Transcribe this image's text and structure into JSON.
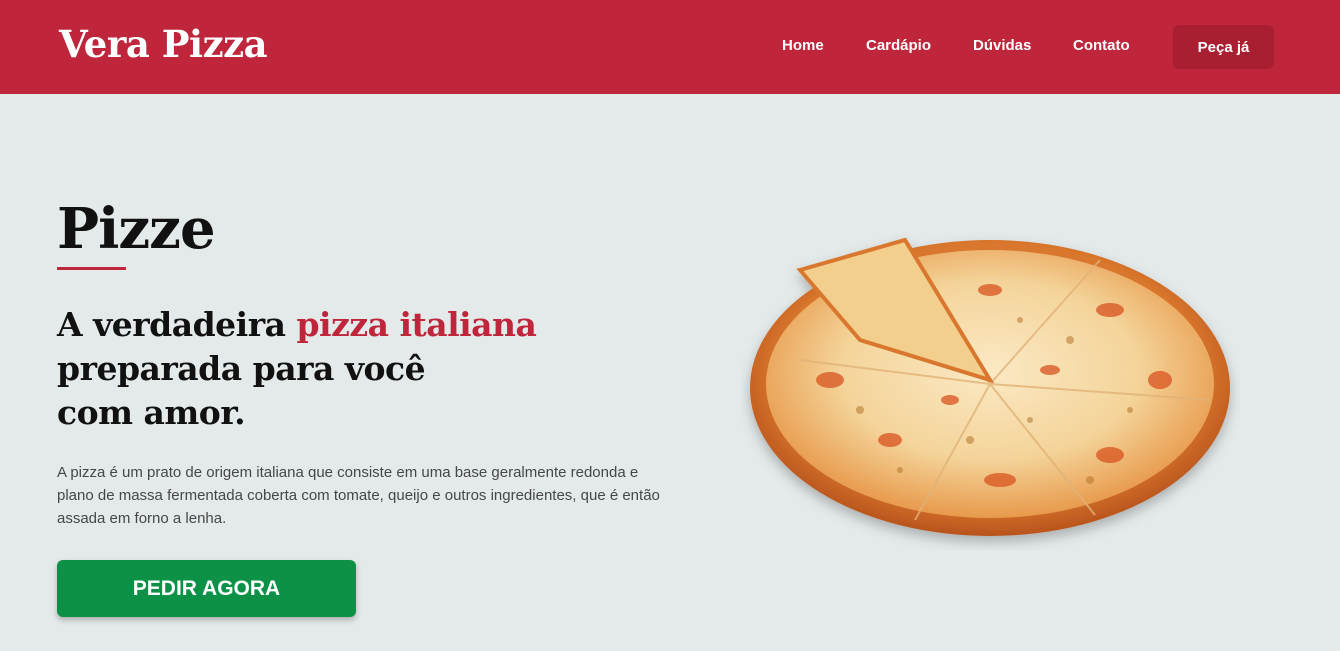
{
  "header": {
    "brand": "Vera Pizza",
    "nav": [
      "Home",
      "Cardápio",
      "Dúvidas",
      "Contato"
    ],
    "order_button": "Peça já"
  },
  "hero": {
    "title": "Pizze",
    "headline_part1": "A verdadeira ",
    "headline_accent": "pizza italiana",
    "headline_line2": "preparada para você",
    "headline_line3": "com amor.",
    "description": "A pizza é um prato de origem italiana que consiste em uma base geralmente redonda e plano de massa fermentada coberta com tomate, queijo e outros ingredientes, que é então assada em forno a lenha.",
    "cta": "PEDIR AGORA"
  },
  "colors": {
    "brand_red": "#bf263b",
    "button_dark_red": "#a91f31",
    "cta_green": "#0d9146",
    "background": "#e4e9ea"
  },
  "images": {
    "hero_image": "pizza-image"
  }
}
